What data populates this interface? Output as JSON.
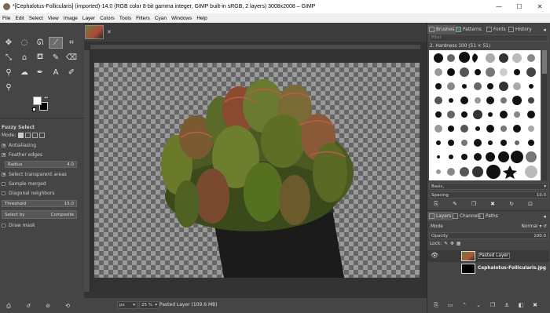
{
  "window": {
    "title": "*[Cephalotus-Follicularis] (imported)-14.0 (RGB color 8-bit gamma integer, GIMP built-in sRGB, 2 layers) 3008x2008 – GIMP",
    "minimize": "—",
    "maximize": "☐",
    "close": "✕"
  },
  "menu": [
    "File",
    "Edit",
    "Select",
    "View",
    "Image",
    "Layer",
    "Colors",
    "Tools",
    "Filters",
    "Cyan",
    "Windows",
    "Help"
  ],
  "tool_options": {
    "title": "Fuzzy Select",
    "mode_label": "Mode:",
    "antialiasing": "Antialiasing",
    "feather_edges": "Feather edges",
    "radius_label": "Radius",
    "radius_value": "4.0",
    "select_transparent": "Select transparent areas",
    "sample_merged": "Sample merged",
    "diagonal_neighbors": "Diagonal neighbors",
    "threshold_label": "Threshold",
    "threshold_value": "15.0",
    "select_by_label": "Select by",
    "select_by_value": "Composite",
    "draw_mask": "Draw mask"
  },
  "image_tab": {
    "close": "✕"
  },
  "status": {
    "unit": "px",
    "zoom": "25 %",
    "message": "Pasted Layer (109.6 MB)"
  },
  "right_dock": {
    "tabs": [
      "Brushes",
      "Patterns",
      "Fonts",
      "History"
    ],
    "filter_placeholder": "filter",
    "brush_name": "2. Hardness 100 (51 × 51)",
    "preset": "Basic,",
    "spacing_label": "Spacing",
    "spacing_value": "10.0",
    "layer_tabs": [
      "Layers",
      "Channels",
      "Paths"
    ],
    "mode_label": "Mode",
    "mode_value": "Normal",
    "opacity_label": "Opacity",
    "opacity_value": "100.0",
    "lock_label": "Lock:",
    "layers": [
      {
        "name": "Pasted Layer"
      },
      {
        "name": "Cephalotus-Follicularis.jpg"
      }
    ]
  }
}
